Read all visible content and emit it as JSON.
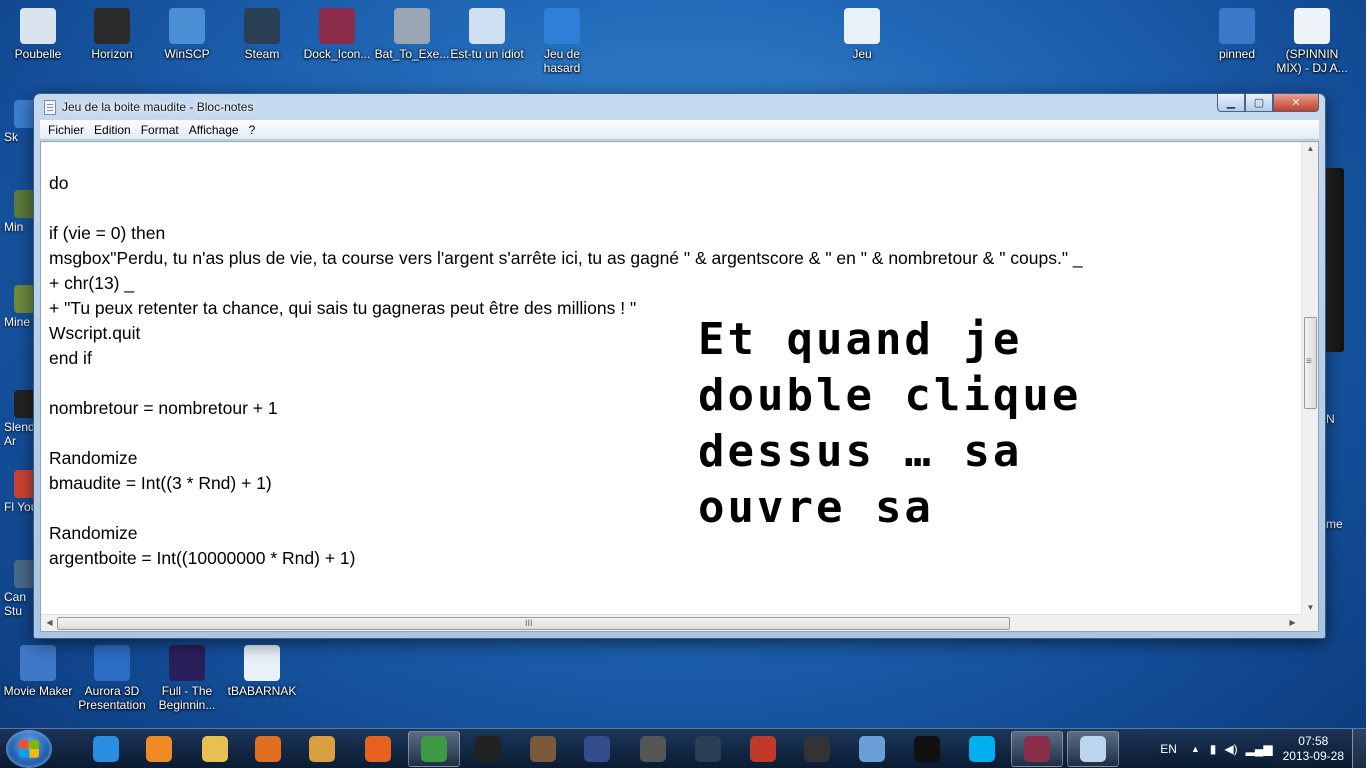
{
  "desktop": {
    "top_icons": [
      {
        "label": "Poubelle",
        "icon": "recycle-bin-icon",
        "color": "#d9e4ef"
      },
      {
        "label": "Horizon",
        "icon": "xbox-icon",
        "color": "#2b2b2b"
      },
      {
        "label": "WinSCP",
        "icon": "winscp-icon",
        "color": "#4a8fd4"
      },
      {
        "label": "Steam",
        "icon": "steam-icon",
        "color": "#2a3f55"
      },
      {
        "label": "Dock_Icon...",
        "icon": "winrar-icon",
        "color": "#8b2c4a"
      },
      {
        "label": "Bat_To_Exe...",
        "icon": "gear-icon",
        "color": "#9aa6b3"
      },
      {
        "label": "Est-tu un idiot",
        "icon": "script-icon",
        "color": "#cfe0f2"
      },
      {
        "label": "Jeu de hasard",
        "icon": "help-icon",
        "color": "#2f7fd9"
      },
      {
        "label": "Jeu",
        "icon": "vbs-script-icon",
        "color": "#e8f0f8"
      },
      {
        "label": "pinned",
        "icon": "pinned-icon",
        "color": "#3a78c8"
      },
      {
        "label": "(SPINNIN MIX) - DJ A...",
        "icon": "mp3-icon",
        "color": "#eef3f8"
      }
    ],
    "bottom_icons": [
      {
        "label": "Movie Maker",
        "icon": "movie-maker-icon",
        "color": "#3f78c7"
      },
      {
        "label": "Aurora 3D Presentation",
        "icon": "aurora-3d-icon",
        "color": "#2b6cc4"
      },
      {
        "label": "Full - The Beginnin...",
        "icon": "video-thumbnail-icon",
        "color": "#2a1f5a"
      },
      {
        "label": "tBABARNAK",
        "icon": "vbs-script-icon",
        "color": "#e8f0f8"
      }
    ],
    "left_edge_labels": [
      "Sk",
      "Min",
      "Mine",
      "Slend Ar",
      "Fl Yout",
      "Can Stu"
    ],
    "right_edge_labels": [
      "N",
      "me"
    ]
  },
  "notepad": {
    "title": "Jeu de la boite maudite - Bloc-notes",
    "buttons": {
      "minimize": "▁",
      "maximize": "▢",
      "close": "✕"
    },
    "menu": [
      "Fichier",
      "Edition",
      "Format",
      "Affichage",
      "?"
    ],
    "lines": [
      "do",
      "",
      "if (vie = 0) then",
      "msgbox\"Perdu, tu n'as plus de vie, ta course vers l'argent s'arrête ici, tu as gagné \" & argentscore & \" en \" & nombretour & \" coups.\" _",
      "+ chr(13) _",
      "+ \"Tu peux retenter ta chance, qui sais tu gagneras peut être des millions ! \"",
      "Wscript.quit",
      "end if",
      "",
      "nombretour = nombretour + 1",
      "",
      "Randomize",
      "bmaudite = Int((3 * Rnd) + 1)",
      "",
      "Randomize",
      "argentboite = Int((10000000 * Rnd) + 1)"
    ],
    "scroll_grip": "≡",
    "hscroll_grip": "III"
  },
  "overlay": {
    "lines": [
      "Et quand je",
      "double clique",
      "dessus … sa",
      "ouvre sa"
    ]
  },
  "taskbar": {
    "apps": [
      {
        "name": "internet-explorer",
        "color": "#2a8de0"
      },
      {
        "name": "media-player",
        "color": "#f08a24"
      },
      {
        "name": "file-explorer",
        "color": "#e6c050"
      },
      {
        "name": "spider-app",
        "color": "#e07020"
      },
      {
        "name": "paint",
        "color": "#d9a040"
      },
      {
        "name": "firefox",
        "color": "#e8611f"
      },
      {
        "name": "chrome",
        "color": "#3d9b46"
      },
      {
        "name": "skull-app",
        "color": "#222222"
      },
      {
        "name": "minecraft-char",
        "color": "#7a5a3a"
      },
      {
        "name": "virtual-dj",
        "color": "#344d8c"
      },
      {
        "name": "obs",
        "color": "#555555"
      },
      {
        "name": "steam",
        "color": "#2a3f55"
      },
      {
        "name": "tool-red",
        "color": "#c0392b"
      },
      {
        "name": "film-reel",
        "color": "#333333"
      },
      {
        "name": "network-app",
        "color": "#6a9fd8"
      },
      {
        "name": "live-app",
        "color": "#111111"
      },
      {
        "name": "skype",
        "color": "#00aff0"
      },
      {
        "name": "winrar",
        "color": "#8b2c4a"
      },
      {
        "name": "notepad",
        "color": "#bcd4ee"
      }
    ],
    "language": "EN",
    "time": "07:58",
    "date": "2013-09-28"
  }
}
